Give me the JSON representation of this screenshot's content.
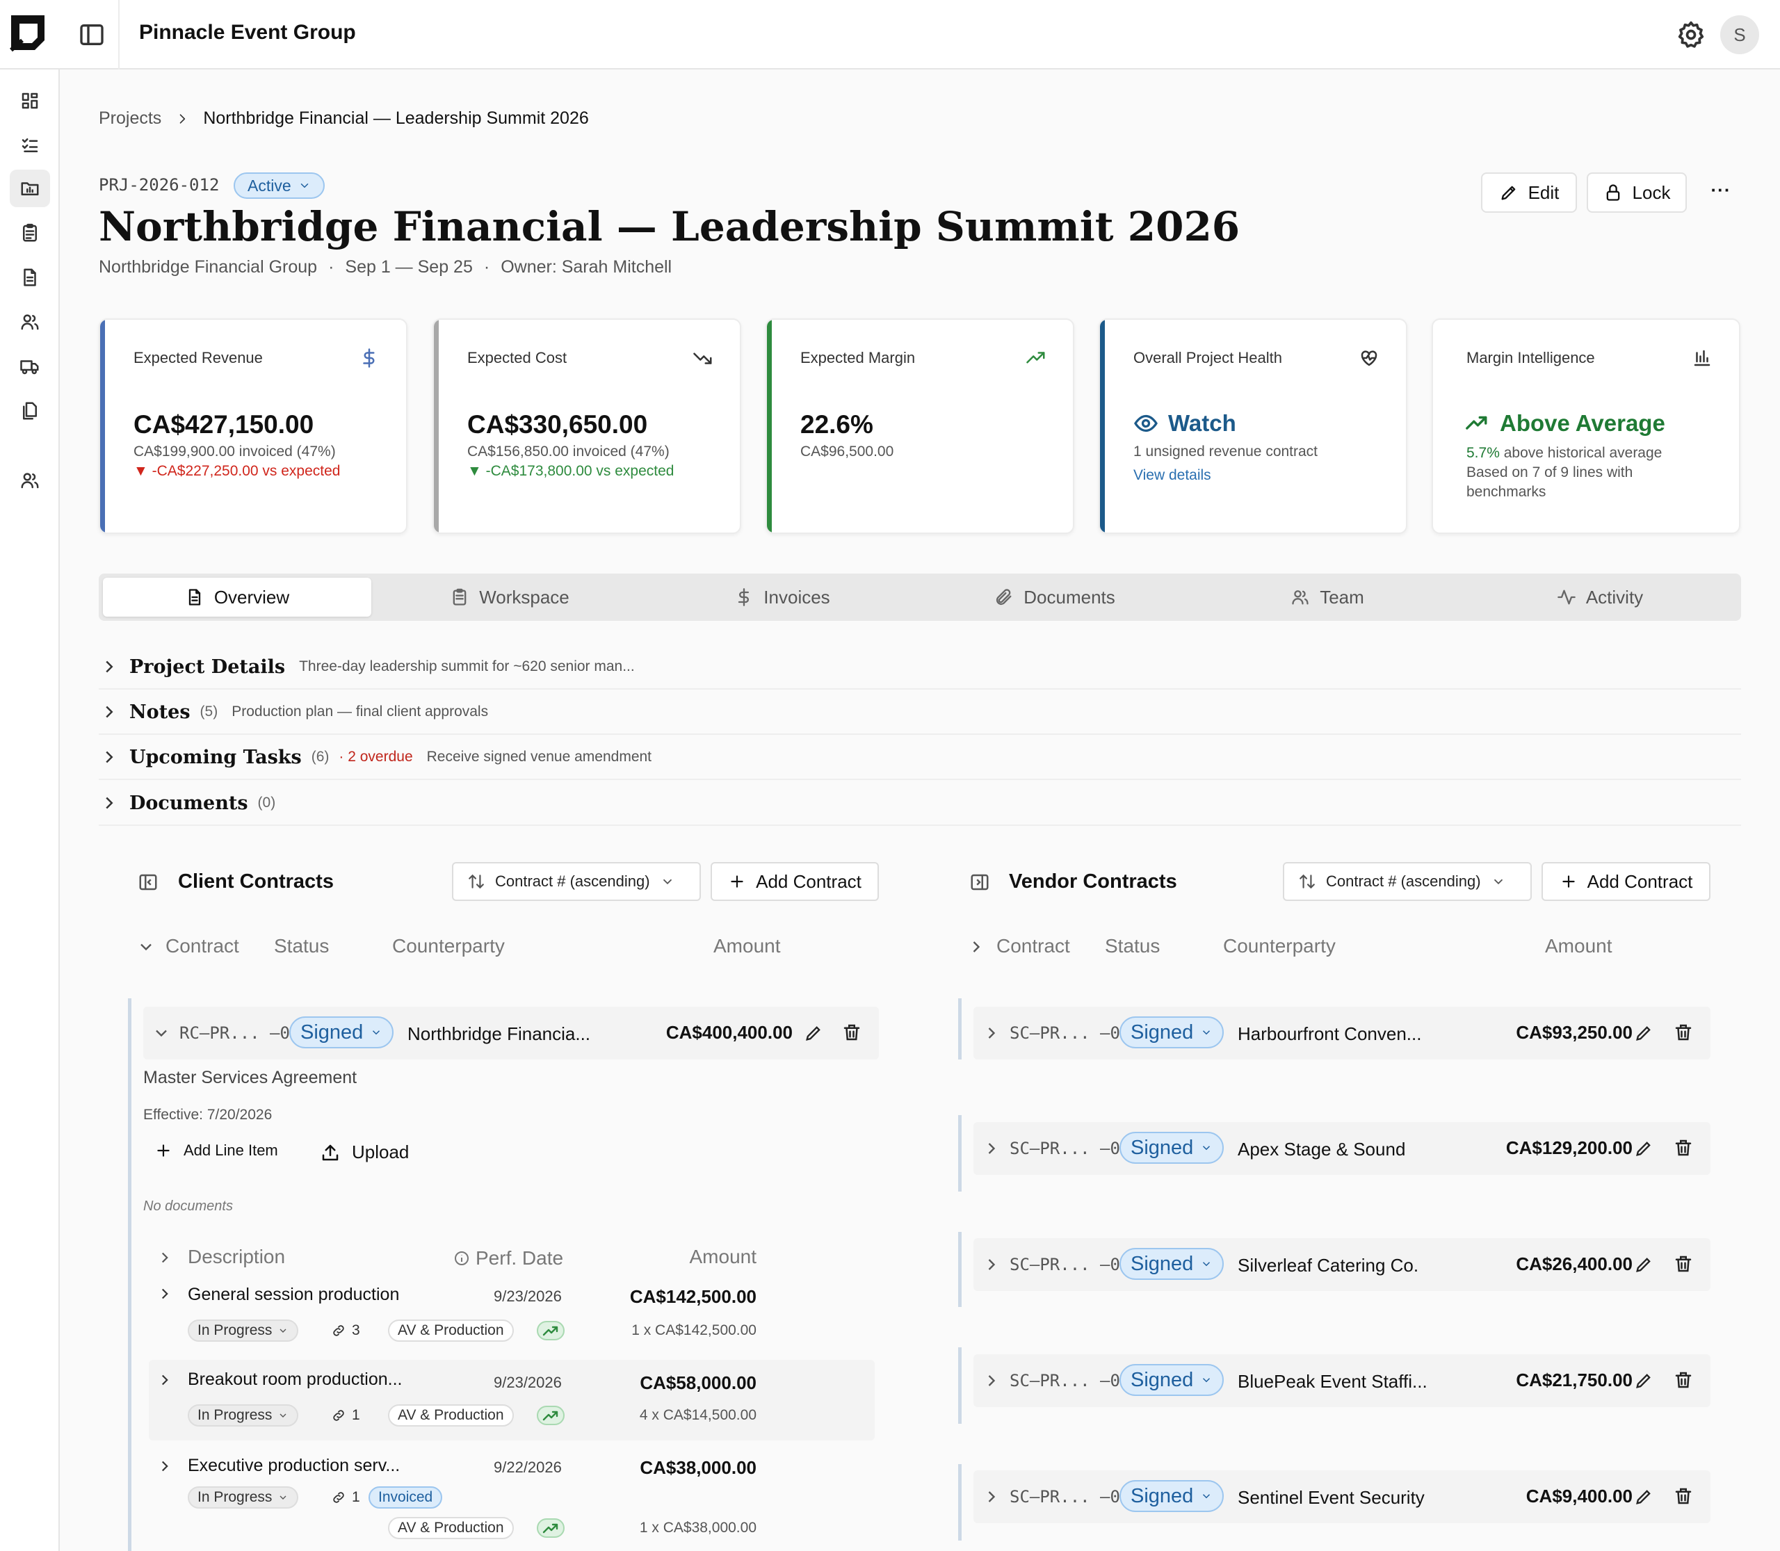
{
  "app": {
    "title": "Pinnacle Event Group",
    "avatar_initial": "S"
  },
  "sidebar": {
    "items": [
      {
        "icon": "dashboard-icon"
      },
      {
        "icon": "list-check-icon"
      },
      {
        "icon": "projects-folder-icon",
        "active": true
      },
      {
        "icon": "clipboard-icon"
      },
      {
        "icon": "document-icon"
      },
      {
        "icon": "users-icon"
      },
      {
        "icon": "truck-icon"
      },
      {
        "icon": "files-icon"
      },
      {
        "icon": "team-icon"
      }
    ]
  },
  "breadcrumb": {
    "root": "Projects",
    "current": "Northbridge Financial — Leadership Summit 2026"
  },
  "project": {
    "id": "PRJ-2026-012",
    "status": "Active",
    "title": "Northbridge Financial — Leadership Summit 2026",
    "client": "Northbridge Financial Group",
    "dates": "Sep 1 — Sep 25",
    "owner": "Owner: Sarah Mitchell",
    "sep": "·"
  },
  "actions": {
    "edit": "Edit",
    "lock": "Lock",
    "more": "···"
  },
  "cards": {
    "revenue": {
      "label": "Expected Revenue",
      "value": "CA$427,150.00",
      "sub": "CA$199,900.00 invoiced (47%)",
      "delta": "▼ -CA$227,250.00 vs expected"
    },
    "cost": {
      "label": "Expected Cost",
      "value": "CA$330,650.00",
      "sub": "CA$156,850.00 invoiced (47%)",
      "delta": "▼ -CA$173,800.00 vs expected"
    },
    "margin": {
      "label": "Expected Margin",
      "value": "22.6%",
      "sub": "CA$96,500.00"
    },
    "health": {
      "label": "Overall Project Health",
      "value": "Watch",
      "sub": "1 unsigned revenue contract",
      "link": "View details"
    },
    "intel": {
      "label": "Margin Intelligence",
      "value": "Above Average",
      "pct": "5.7%",
      "sub": " above historical average",
      "sub2": "Based on 7 of 9 lines with",
      "sub3": "benchmarks"
    }
  },
  "colors": {
    "revenue": "#4a6fb5",
    "cost": "#a8a8a8",
    "margin": "#2e8b3e",
    "health": "#1c5a8a",
    "green": "#2e8b3e",
    "red": "#d0261c",
    "link": "#2a6fb0"
  },
  "tabs": [
    {
      "label": "Overview",
      "icon": "document-icon",
      "active": true
    },
    {
      "label": "Workspace",
      "icon": "clipboard-icon"
    },
    {
      "label": "Invoices",
      "icon": "dollar-icon"
    },
    {
      "label": "Documents",
      "icon": "paperclip-icon"
    },
    {
      "label": "Team",
      "icon": "users-icon"
    },
    {
      "label": "Activity",
      "icon": "activity-icon"
    }
  ],
  "sections": {
    "details": {
      "title": "Project Details",
      "preview": "Three-day leadership summit for ~620 senior man..."
    },
    "notes": {
      "title": "Notes",
      "count": "(5)",
      "preview": "Production plan — final client approvals"
    },
    "tasks": {
      "title": "Upcoming Tasks",
      "count": "(6)",
      "overdue": "· 2 overdue",
      "preview": "Receive signed venue amendment"
    },
    "documents": {
      "title": "Documents",
      "count": "(0)"
    }
  },
  "client_contracts": {
    "title": "Client Contracts",
    "sort": "Contract # (ascending)",
    "add": "Add Contract",
    "headers": {
      "contract": "Contract",
      "status": "Status",
      "counterparty": "Counterparty",
      "amount": "Amount"
    },
    "row": {
      "id": "RC–PR... –01",
      "status": "Signed",
      "counterparty": "Northbridge Financia...",
      "amount": "CA$400,400.00"
    },
    "detail": {
      "type": "Master Services Agreement",
      "effective": "Effective: 7/20/2026",
      "add_line": "Add Line Item",
      "upload": "Upload",
      "no_docs": "No documents"
    },
    "line_headers": {
      "description": "Description",
      "perf_date": "Perf. Date",
      "amount": "Amount"
    },
    "lines": [
      {
        "title": "General session production",
        "date": "9/23/2026",
        "amount": "CA$142,500.00",
        "status": "In Progress",
        "links": "3",
        "category": "AV & Production",
        "qty": "1 x CA$142,500.00"
      },
      {
        "title": "Breakout room production...",
        "date": "9/23/2026",
        "amount": "CA$58,000.00",
        "status": "In Progress",
        "links": "1",
        "category": "AV & Production",
        "qty": "4 x CA$14,500.00"
      },
      {
        "title": "Executive production serv...",
        "date": "9/22/2026",
        "amount": "CA$38,000.00",
        "status": "In Progress",
        "links": "1",
        "badge": "Invoiced",
        "category": "AV & Production",
        "qty": "1 x CA$38,000.00"
      }
    ]
  },
  "vendor_contracts": {
    "title": "Vendor Contracts",
    "sort": "Contract # (ascending)",
    "add": "Add Contract",
    "headers": {
      "contract": "Contract",
      "status": "Status",
      "counterparty": "Counterparty",
      "amount": "Amount"
    },
    "rows": [
      {
        "id": "SC–PR... –01",
        "status": "Signed",
        "counterparty": "Harbourfront Conven...",
        "amount": "CA$93,250.00"
      },
      {
        "id": "SC–PR... –02",
        "status": "Signed",
        "counterparty": "Apex Stage & Sound",
        "amount": "CA$129,200.00"
      },
      {
        "id": "SC–PR... –03",
        "status": "Signed",
        "counterparty": "Silverleaf Catering Co.",
        "amount": "CA$26,400.00"
      },
      {
        "id": "SC–PR... –04",
        "status": "Signed",
        "counterparty": "BluePeak Event Staffi...",
        "amount": "CA$21,750.00"
      },
      {
        "id": "SC–PR... –05",
        "status": "Signed",
        "counterparty": "Sentinel Event Security",
        "amount": "CA$9,400.00"
      }
    ]
  }
}
